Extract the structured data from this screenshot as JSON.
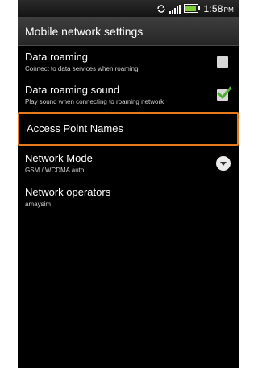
{
  "status": {
    "time": "1:58",
    "ampm": "PM"
  },
  "header": {
    "title": "Mobile network settings"
  },
  "settings": [
    {
      "title": "Data roaming",
      "subtitle": "Connect to data services when roaming",
      "control": "checkbox",
      "checked": false
    },
    {
      "title": "Data roaming sound",
      "subtitle": "Play sound when connecting to roaming network",
      "control": "checkbox",
      "checked": true
    },
    {
      "title": "Access Point Names",
      "highlighted": true
    },
    {
      "title": "Network Mode",
      "subtitle": "GSM / WCDMA auto",
      "control": "dropdown"
    },
    {
      "title": "Network operators",
      "subtitle": "amaysim"
    }
  ],
  "colors": {
    "highlight": "#e67a1a",
    "check": "#4caf30",
    "background": "#000000"
  }
}
